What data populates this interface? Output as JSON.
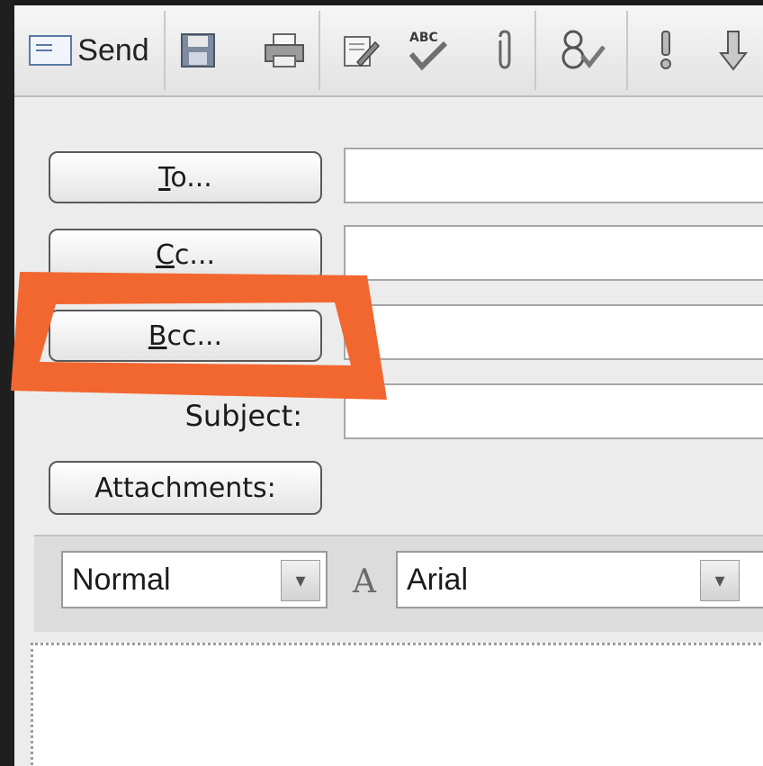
{
  "toolbar": {
    "send_label": "Send",
    "buttons": [
      {
        "name": "send-icon"
      },
      {
        "name": "save-icon",
        "glyph": "▦"
      },
      {
        "name": "print-icon",
        "glyph": "⎙"
      },
      {
        "name": "edit-icon",
        "glyph": "✎"
      },
      {
        "name": "spellcheck-icon",
        "glyph": "✓"
      },
      {
        "name": "attach-icon",
        "glyph": "𝟘"
      },
      {
        "name": "address-book-icon",
        "glyph": "8"
      },
      {
        "name": "priority-high-icon",
        "glyph": "!"
      },
      {
        "name": "priority-low-icon",
        "glyph": "⇩"
      }
    ],
    "spellcheck_text": "ABC"
  },
  "form": {
    "to_button": "To...",
    "cc_button": "Cc...",
    "bcc_button": "Bcc...",
    "subject_label": "Subject:",
    "attachments_button": "Attachments:",
    "to_value": "",
    "cc_value": "",
    "bcc_value": "",
    "subject_value": ""
  },
  "format": {
    "style_value": "Normal",
    "font_value": "Arial"
  },
  "highlight": {
    "color": "#f2672f",
    "target": "bcc-button"
  }
}
